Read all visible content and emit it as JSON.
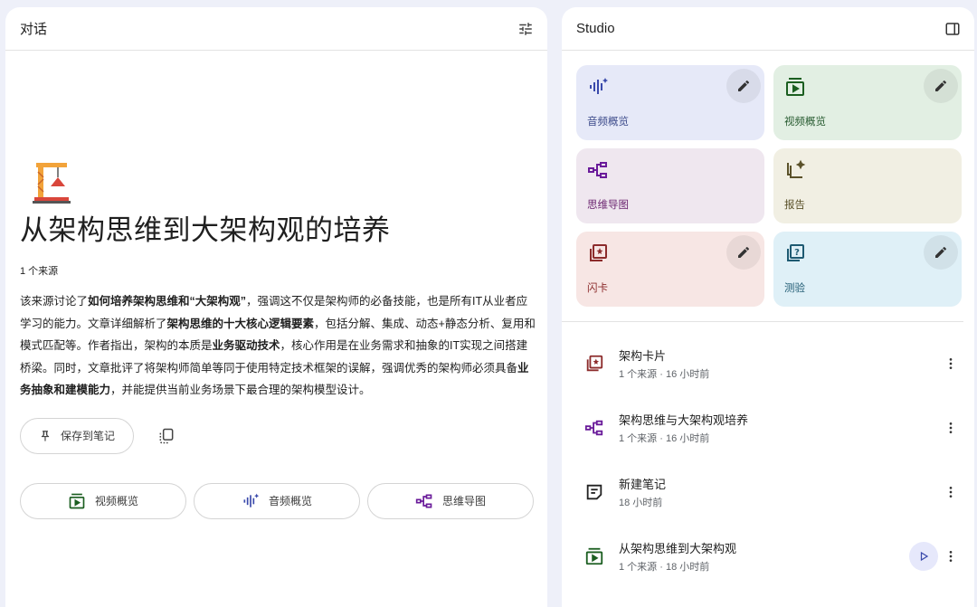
{
  "chat": {
    "title": "对话",
    "doc_title": "从架构思维到大架构观的培养",
    "source_count": "1 个来源",
    "summary": {
      "p1": "该来源讨论了",
      "b1": "如何培养架构思维和“大架构观”",
      "p2": "，强调这不仅是架构师的必备技能，也是所有IT从业者应学习的能力。文章详细解析了",
      "b2": "架构思维的十大核心逻辑要素",
      "p3": "，包括分解、集成、动态+静态分析、复用和模式匹配等。作者指出，架构的本质是",
      "b3": "业务驱动技术",
      "p4": "，核心作用是在业务需求和抽象的IT实现之间搭建桥梁。同时，文章批评了将架构师简单等同于使用特定技术框架的误解，强调优秀的架构师必须具备",
      "b4": "业务抽象和建模能力",
      "p5": "，并能提供当前业务场景下最合理的架构模型设计。"
    },
    "save_label": "保存到笔记",
    "actions": {
      "video": "视频概览",
      "audio": "音频概览",
      "mindmap": "思维导图"
    }
  },
  "studio": {
    "title": "Studio",
    "tiles": {
      "audio": "音频概览",
      "video": "视频概览",
      "mindmap": "思维导图",
      "report": "报告",
      "flashcard": "闪卡",
      "quiz": "测验"
    },
    "notes": [
      {
        "title": "架构卡片",
        "meta": "1 个来源 · 16 小时前"
      },
      {
        "title": "架构思维与大架构观培养",
        "meta": "1 个来源 · 16 小时前"
      },
      {
        "title": "新建笔记",
        "meta": "18 小时前"
      },
      {
        "title": "从架构思维到大架构观",
        "meta": "1 个来源 · 18 小时前"
      }
    ]
  },
  "colors": {
    "background": "#eef0f9",
    "audio_tile": "#e6e9f8",
    "video_tile": "#e2efe3",
    "mindmap_tile": "#efe7ef",
    "report_tile": "#f1efe3",
    "flashcard_tile": "#f7e6e4",
    "quiz_tile": "#dff0f7"
  }
}
